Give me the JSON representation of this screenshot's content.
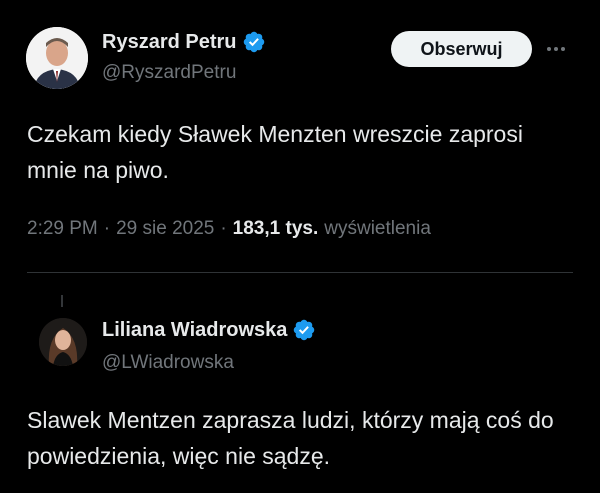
{
  "tweet": {
    "author": {
      "name": "Ryszard Petru",
      "handle": "@RyszardPetru",
      "verified": true
    },
    "follow_label": "Obserwuj",
    "more_icon": "more-horizontal-icon",
    "text": "Czekam kiedy Sławek Menzten wreszcie zaprosi mnie na piwo.",
    "time": "2:29 PM",
    "date": "29 sie 2025",
    "views_count": "183,1 tys.",
    "views_label": "wyświetlenia",
    "separator": "·"
  },
  "reply": {
    "author": {
      "name": "Liliana Wiadrowska",
      "handle": "@LWiadrowska",
      "verified": true
    },
    "text": "Slawek Mentzen zaprasza ludzi, którzy mają coś do powiedzienia, więc nie sądzę."
  },
  "colors": {
    "background": "#000000",
    "text": "#e7e9ea",
    "secondary": "#71767b",
    "verified": "#1d9bf0",
    "button_bg": "#eff3f4"
  }
}
